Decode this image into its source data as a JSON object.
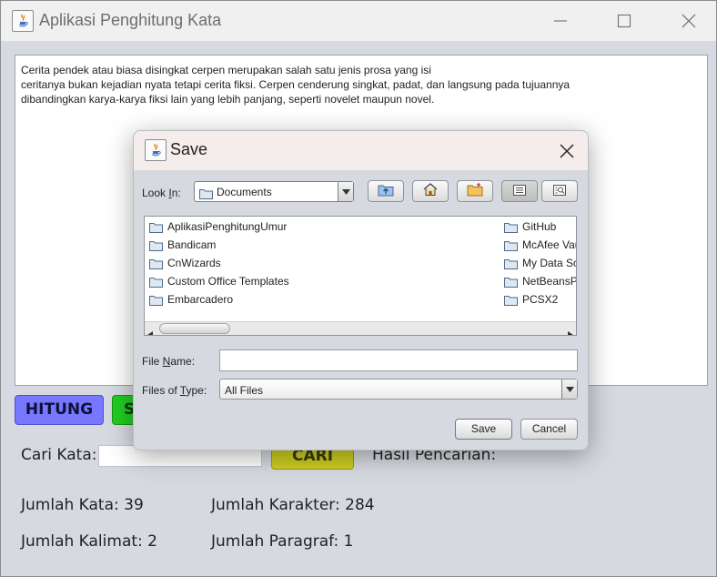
{
  "window": {
    "title": "Aplikasi Penghitung Kata",
    "text_content": "Cerita pendek atau biasa disingkat cerpen merupakan salah satu jenis prosa yang isi\nceritanya bukan kejadian nyata tetapi cerita fiksi. Cerpen cenderung singkat, padat, dan langsung pada tujuannya\ndibandingkan karya-karya fiksi lain yang lebih panjang, seperti novelet maupun novel.",
    "buttons": {
      "hitung": "HITUNG",
      "simpan": "S",
      "cari": "CARI"
    },
    "search": {
      "label": "Cari Kata:",
      "value": "",
      "result_label": "Hasil Pencarian:"
    },
    "stats": {
      "kata": "Jumlah Kata: 39",
      "karakter": "Jumlah Karakter: 284",
      "kalimat": "Jumlah Kalimat: 2",
      "paragraf": "Jumlah Paragraf: 1"
    },
    "colors": {
      "hitung": "#7777ff",
      "simpan": "#22cc22",
      "cari": "#cccc22"
    }
  },
  "dialog": {
    "title": "Save",
    "look_in": {
      "label_pre": "Look ",
      "label_key": "I",
      "label_post": "n:",
      "value": "Documents"
    },
    "files_left": [
      "AplikasiPenghitungUmur",
      "Bandicam",
      "CnWizards",
      "Custom Office Templates",
      "Embarcadero"
    ],
    "files_right": [
      "GitHub",
      "McAfee Vau",
      "My Data So",
      "NetBeansP",
      "PCSX2"
    ],
    "file_name": {
      "label_pre": "File ",
      "label_key": "N",
      "label_post": "ame:",
      "value": ""
    },
    "files_of_type": {
      "label_pre": "Files of ",
      "label_key": "T",
      "label_post": "ype:",
      "value": "All Files"
    },
    "save_label": "Save",
    "cancel_label": "Cancel"
  }
}
